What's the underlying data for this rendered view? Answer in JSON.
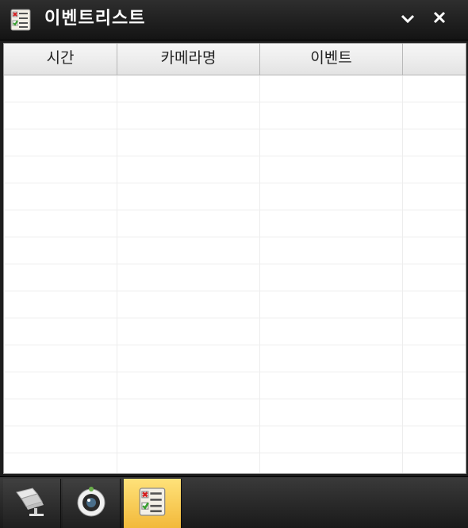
{
  "window": {
    "title": "이벤트리스트",
    "title_icon": "event-list-icon",
    "collapse_icon": "chevron-down-icon",
    "close_icon": "close-icon"
  },
  "table": {
    "columns": [
      "시간",
      "카메라명",
      "이벤트",
      ""
    ],
    "rows": []
  },
  "toolbar": {
    "buttons": [
      {
        "icon": "cctv-camera-icon",
        "active": false
      },
      {
        "icon": "webcam-icon",
        "active": false
      },
      {
        "icon": "event-list-icon",
        "active": true
      }
    ]
  },
  "colors": {
    "title_bar": "#1d1d1d",
    "active_tab": "#f5c44a"
  }
}
